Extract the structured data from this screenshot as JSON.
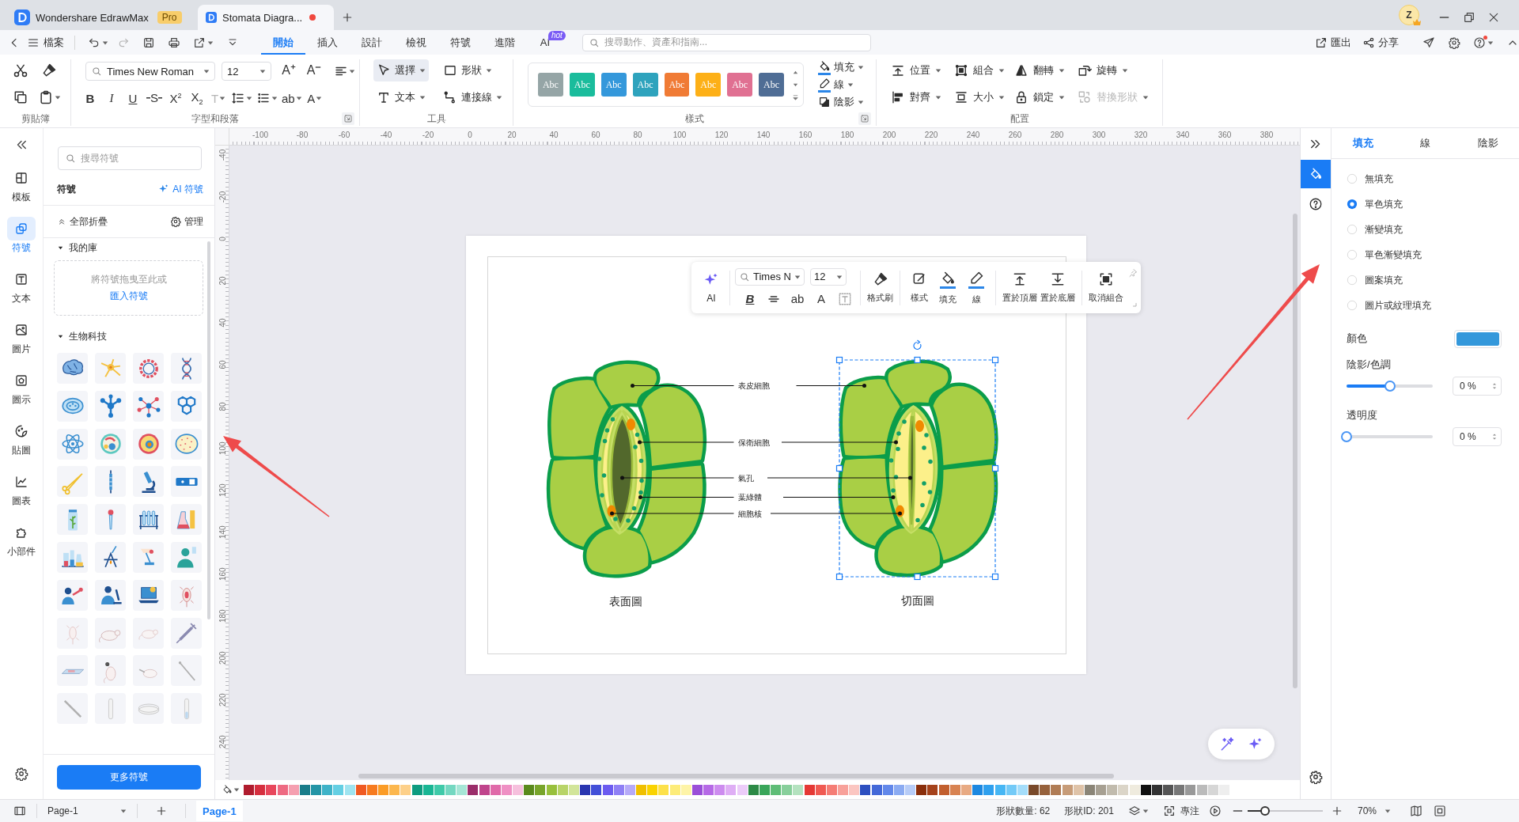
{
  "title_bar": {
    "tabs": [
      {
        "label": "Wondershare EdrawMax",
        "badge": "Pro",
        "selected": false,
        "unsaved": false
      },
      {
        "label": "Stomata Diagra...",
        "selected": true,
        "unsaved": true
      }
    ],
    "avatar": "Z"
  },
  "menu_bar": {
    "file": "檔案",
    "tabs": [
      {
        "label": "開始",
        "selected": true
      },
      {
        "label": "插入",
        "selected": false
      },
      {
        "label": "設計",
        "selected": false
      },
      {
        "label": "檢視",
        "selected": false
      },
      {
        "label": "符號",
        "selected": false
      },
      {
        "label": "進階",
        "selected": false
      },
      {
        "label": "AI",
        "badge": "hot",
        "selected": false
      }
    ],
    "search": {
      "placeholder": "搜尋動作、資產和指南..."
    },
    "export": "匯出",
    "share": "分享",
    "help_alert": true
  },
  "ribbon": {
    "clipboard": {
      "label": "剪貼簿"
    },
    "font": {
      "label": "字型和段落",
      "font_name": "Times New Roman",
      "font_size": "12",
      "grow": "A",
      "shrink": "A",
      "format": [
        {
          "text": "B",
          "kind": "bold",
          "disabled": false
        },
        {
          "text": "I",
          "kind": "italic",
          "disabled": false
        },
        {
          "text": "U",
          "kind": "underline",
          "disabled": false
        },
        {
          "text": "S",
          "kind": "strike",
          "disabled": false
        },
        {
          "text": "X$^{2}$",
          "kind": "plain",
          "disabled": false
        },
        {
          "text": "X$_{2}$",
          "kind": "plain",
          "disabled": false
        },
        {
          "text": "T",
          "kind": "menu",
          "disabled": true
        },
        {
          "text": "ab",
          "kind": "menu",
          "disabled": false
        },
        {
          "text": "A",
          "kind": "menu",
          "disabled": false
        }
      ]
    },
    "tools": {
      "label": "工具",
      "items": [
        {
          "label": "選擇",
          "selected": true
        },
        {
          "label": "形狀",
          "selected": false
        },
        {
          "label": "文本",
          "selected": false
        },
        {
          "label": "連接線",
          "selected": false
        }
      ]
    },
    "styles": {
      "label": "樣式",
      "swatches": [
        {
          "text": "Abc",
          "color": "#95a5a6"
        },
        {
          "text": "Abc",
          "color": "#1abc9c"
        },
        {
          "text": "Abc",
          "color": "#3498db"
        },
        {
          "text": "Abc",
          "color": "#2ea3bd"
        },
        {
          "text": "Abc",
          "color": "#f07b35"
        },
        {
          "text": "Abc",
          "color": "#fdb017"
        },
        {
          "text": "Abc",
          "color": "#e07092"
        },
        {
          "text": "Abc",
          "color": "#4f6d95"
        }
      ],
      "fill": "填充",
      "line": "線",
      "shadow": "陰影"
    },
    "arrange": {
      "label": "配置",
      "items": [
        {
          "label": "位置",
          "disabled": false
        },
        {
          "label": "組合",
          "disabled": false
        },
        {
          "label": "翻轉",
          "disabled": false
        },
        {
          "label": "旋轉",
          "disabled": false
        },
        {
          "label": "對齊",
          "disabled": false
        },
        {
          "label": "大小",
          "disabled": false
        },
        {
          "label": "鎖定",
          "disabled": false
        },
        {
          "label": "替換形狀",
          "disabled": true
        }
      ]
    }
  },
  "left_rail": {
    "items": [
      {
        "label": "模板",
        "selected": false
      },
      {
        "label": "符號",
        "selected": true
      },
      {
        "label": "文本",
        "selected": false
      },
      {
        "label": "圖片",
        "selected": false
      },
      {
        "label": "圖示",
        "selected": false
      },
      {
        "label": "貼圖",
        "selected": false
      },
      {
        "label": "圖表",
        "selected": false
      },
      {
        "label": "小部件",
        "selected": false
      }
    ]
  },
  "symbol_panel": {
    "search": {
      "placeholder": "搜尋符號"
    },
    "title": "符號",
    "ai_link": "AI 符號",
    "collapse_all": "全部折疊",
    "manage": "管理",
    "sections": [
      {
        "title": "我的庫",
        "kind": "drop_area",
        "expanded": true,
        "hint": "將符號拖曳至此或",
        "link": "匯入符號"
      },
      {
        "title": "生物科技",
        "kind": "symbols",
        "expanded": true
      }
    ],
    "more_button": "更多符號"
  },
  "ruler": {
    "horizontal": [
      "-100",
      "-80",
      "-60",
      "-40",
      "-20",
      "0",
      "20",
      "40",
      "60",
      "80",
      "100",
      "120",
      "140",
      "160",
      "180",
      "200",
      "220",
      "240",
      "260",
      "280",
      "300",
      "320",
      "340",
      "360",
      "380"
    ],
    "vertical": [
      "-40",
      "-20",
      "0",
      "20",
      "40",
      "60",
      "80",
      "100",
      "120",
      "140",
      "160",
      "180",
      "200",
      "220",
      "240"
    ]
  },
  "float_toolbar": {
    "ai": "AI",
    "font_name": "Times N",
    "font_size": "12",
    "format": [
      "B",
      "ab",
      "A"
    ],
    "tools": [
      "格式刷",
      "樣式",
      "填充",
      "線",
      "置於頂層",
      "置於底層",
      "取消組合"
    ]
  },
  "diagram": {
    "labels": [
      "表皮細胞",
      "保衛細胞",
      "氣孔",
      "葉綠體",
      "細胞核"
    ],
    "figures": [
      {
        "caption": "表面圖",
        "kind": "surface",
        "selected": false
      },
      {
        "caption": "切面圖",
        "kind": "section",
        "selected": true
      }
    ]
  },
  "palette": [
    {
      "color": "#b01c2e"
    },
    {
      "color": "#d62f3f"
    },
    {
      "color": "#e8475c"
    },
    {
      "color": "#ee6a82"
    },
    {
      "color": "#f59fb0"
    },
    {
      "color": "#1a7d8a"
    },
    {
      "color": "#2495a6"
    },
    {
      "color": "#3fb3c8"
    },
    {
      "color": "#64cfe3"
    },
    {
      "color": "#9fe4f0"
    },
    {
      "color": "#f05a22"
    },
    {
      "color": "#f77b1f"
    },
    {
      "color": "#fb9c26"
    },
    {
      "color": "#fcb74e"
    },
    {
      "color": "#fdd089"
    },
    {
      "color": "#0e9c80"
    },
    {
      "color": "#19b694"
    },
    {
      "color": "#3fcaa9"
    },
    {
      "color": "#74d8c1"
    },
    {
      "color": "#a6e6d6"
    },
    {
      "color": "#9b2d6a"
    },
    {
      "color": "#c0448c"
    },
    {
      "color": "#e06aa9"
    },
    {
      "color": "#ef90c4"
    },
    {
      "color": "#f6c0dd"
    },
    {
      "color": "#5a8a1c"
    },
    {
      "color": "#78a52a"
    },
    {
      "color": "#98c03c"
    },
    {
      "color": "#b8d468"
    },
    {
      "color": "#d2e59a"
    },
    {
      "color": "#2a36b0"
    },
    {
      "color": "#4350d8"
    },
    {
      "color": "#6c5cf0"
    },
    {
      "color": "#8f80f5"
    },
    {
      "color": "#b6aaf8"
    },
    {
      "color": "#f0c000"
    },
    {
      "color": "#fad300"
    },
    {
      "color": "#fde14a"
    },
    {
      "color": "#fdec79"
    },
    {
      "color": "#fef4a7"
    },
    {
      "color": "#9a4fd8"
    },
    {
      "color": "#b66ae6"
    },
    {
      "color": "#cd8cef"
    },
    {
      "color": "#dfaef5"
    },
    {
      "color": "#ecccf9"
    },
    {
      "color": "#2c8a46"
    },
    {
      "color": "#3aa65a"
    },
    {
      "color": "#5fbd77"
    },
    {
      "color": "#88cf9b"
    },
    {
      "color": "#b4e2bf"
    },
    {
      "color": "#e53935"
    },
    {
      "color": "#f05a52"
    },
    {
      "color": "#f57d75"
    },
    {
      "color": "#f8a19a"
    },
    {
      "color": "#fbc6c1"
    },
    {
      "color": "#2d4fc0"
    },
    {
      "color": "#4469d8"
    },
    {
      "color": "#6288ea"
    },
    {
      "color": "#8babf2"
    },
    {
      "color": "#b7ccf7"
    },
    {
      "color": "#8a2e0b"
    },
    {
      "color": "#a5421b"
    },
    {
      "color": "#c25f2e"
    },
    {
      "color": "#d88352"
    },
    {
      "color": "#e8aa83"
    },
    {
      "color": "#1d88e0"
    },
    {
      "color": "#2fa0ee"
    },
    {
      "color": "#46b6f4"
    },
    {
      "color": "#73caf7"
    },
    {
      "color": "#a4ddfa"
    },
    {
      "color": "#7a4a2a"
    },
    {
      "color": "#97623c"
    },
    {
      "color": "#b07c55"
    },
    {
      "color": "#c79c78"
    },
    {
      "color": "#dfc3a8"
    },
    {
      "color": "#8b8577"
    },
    {
      "color": "#a7a092"
    },
    {
      "color": "#c1bbad"
    },
    {
      "color": "#dbd5c8"
    },
    {
      "color": "#efebde"
    },
    {
      "color": "#111111"
    },
    {
      "color": "#333333"
    },
    {
      "color": "#555555"
    },
    {
      "color": "#777777"
    },
    {
      "color": "#999999"
    },
    {
      "color": "#bbbbbb"
    },
    {
      "color": "#d6d6d6"
    },
    {
      "color": "#eeeeee"
    }
  ],
  "right_panel": {
    "tabs": [
      {
        "label": "填充",
        "selected": true
      },
      {
        "label": "線",
        "selected": false
      },
      {
        "label": "陰影",
        "selected": false
      }
    ],
    "fill_options": [
      {
        "label": "無填充",
        "selected": false
      },
      {
        "label": "單色填充",
        "selected": true
      },
      {
        "label": "漸變填充",
        "selected": false
      },
      {
        "label": "單色漸變填充",
        "selected": false
      },
      {
        "label": "圖案填充",
        "selected": false
      },
      {
        "label": "圖片或紋理填充",
        "selected": false
      }
    ],
    "color": {
      "label": "顏色",
      "color": "#3498db"
    },
    "shade": {
      "label": "陰影/色調",
      "level": 0.5,
      "value": "0 %"
    },
    "transparency": {
      "label": "透明度",
      "level": 0,
      "value": "0 %"
    }
  },
  "status_bar": {
    "page_select": "Page-1",
    "pages": [
      {
        "label": "Page-1",
        "selected": true
      }
    ],
    "shape_count": "形狀數量: 62",
    "shape_id": "形狀ID: 201",
    "focus": "專注",
    "zoom": {
      "level": 0.23,
      "value": "70%"
    }
  }
}
